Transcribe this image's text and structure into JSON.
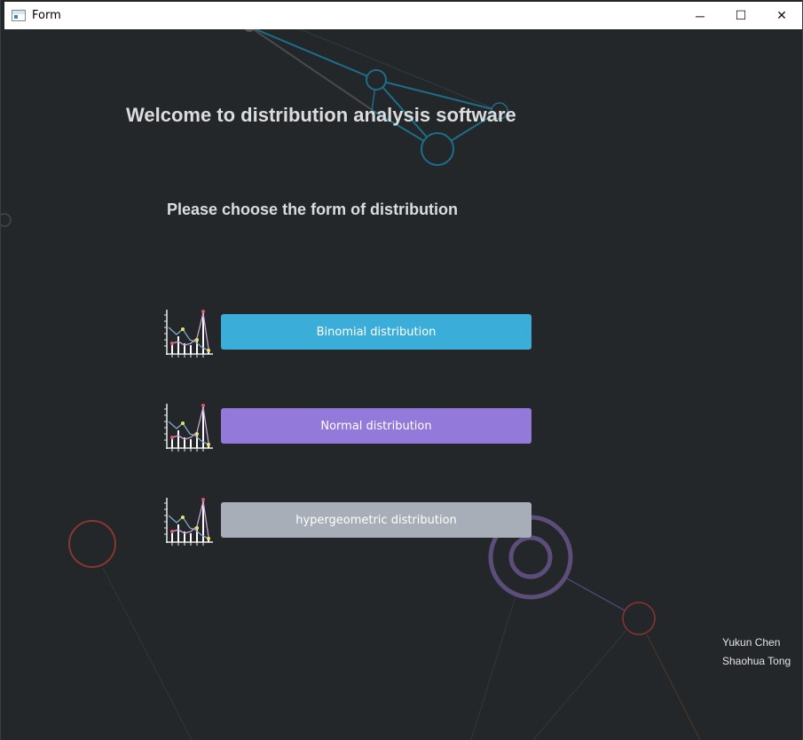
{
  "window": {
    "title": "Form",
    "minimize_glyph": "─",
    "maximize_glyph": "☐",
    "close_glyph": "✕"
  },
  "main": {
    "heading": "Welcome to distribution analysis software",
    "subheading": "Please choose the form of distribution",
    "options": [
      {
        "label": "Binomial distribution",
        "color": "#3aaed8",
        "icon": "line-chart-icon"
      },
      {
        "label": "Normal distribution",
        "color": "#9379d9",
        "icon": "line-chart-icon"
      },
      {
        "label": "hypergeometric distribution",
        "color": "#a8aeb7",
        "icon": "line-chart-icon"
      }
    ]
  },
  "authors": [
    "Yukun Chen",
    "Shaohua Tong"
  ],
  "colors": {
    "background": "#24272a",
    "text": "#dcdcdc",
    "network_blue": "#1c6e8a",
    "circle_red": "#8a3530",
    "circle_purple": "#5c4d7a"
  }
}
